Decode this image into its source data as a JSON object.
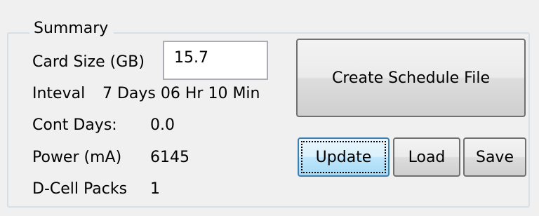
{
  "group": {
    "title": "Summary"
  },
  "card_size": {
    "label": "Card Size (GB)",
    "value": "15.7"
  },
  "interval": {
    "label": "Inteval",
    "value": "7 Days 06 Hr 10 Min"
  },
  "cont_days": {
    "label": "Cont Days:",
    "value": "0.0"
  },
  "power": {
    "label": "Power (mA)",
    "value": "6145"
  },
  "dcell": {
    "label": "D-Cell Packs",
    "value": "1"
  },
  "buttons": {
    "create": "Create Schedule File",
    "update": "Update",
    "load": "Load",
    "save": "Save"
  }
}
